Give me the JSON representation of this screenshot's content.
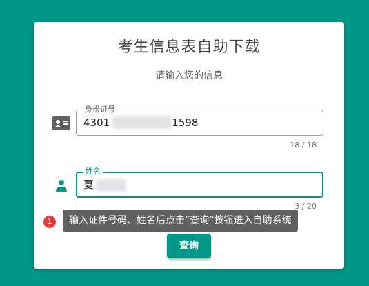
{
  "card": {
    "title": "考生信息表自助下载",
    "subtitle": "请输入您的信息"
  },
  "form": {
    "id_field": {
      "label": "身份证号",
      "value_prefix": "4301",
      "value_suffix": "1598",
      "counter": "18 / 18",
      "icon": "id-card-icon"
    },
    "name_field": {
      "label": "姓名",
      "value": "夏",
      "counter": "3 / 20",
      "icon": "person-icon"
    }
  },
  "tooltip": {
    "step": "1",
    "text": "输入证件号码、姓名后点击“查询”按钮进入自助系统"
  },
  "query_button": {
    "label": "查询"
  },
  "colors": {
    "background": "#009688",
    "accent": "#009688",
    "tooltip_bg": "#616161",
    "badge": "#e53935"
  }
}
